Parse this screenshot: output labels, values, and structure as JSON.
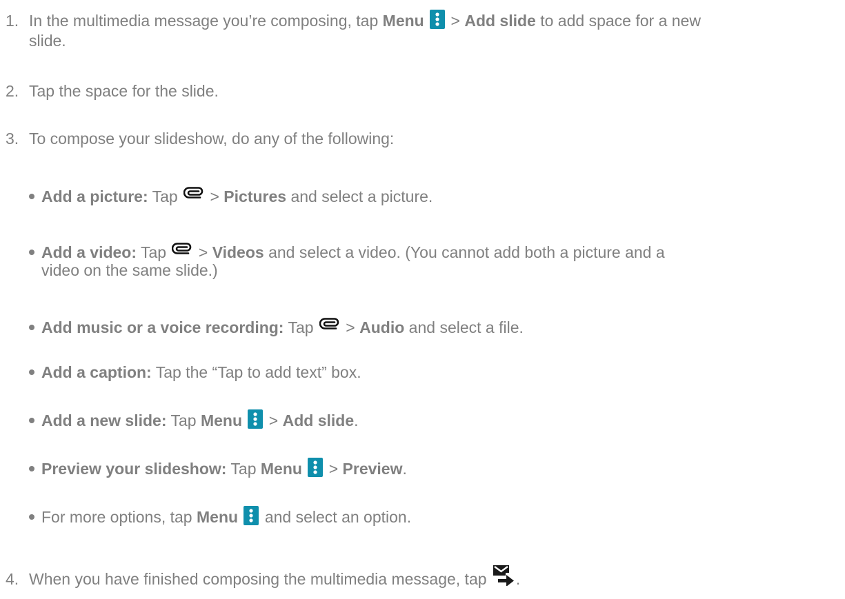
{
  "steps": [
    {
      "num": "1.",
      "line1_pre": "In the multimedia message you’re composing, tap ",
      "menu": "Menu",
      "sep": " > ",
      "target": "Add slide",
      "line1_post": " to add space for a new",
      "line2": "slide."
    },
    {
      "num": "2.",
      "text": "Tap the space for the slide."
    },
    {
      "num": "3.",
      "text": "To compose your slideshow, do any of the following:"
    },
    {
      "num": "4.",
      "text": "When you have finished composing the multimedia message, tap ",
      "end": "."
    }
  ],
  "bullets": [
    {
      "label": "Add a picture:",
      "pre": " Tap ",
      "sep": " > ",
      "target": "Pictures",
      "post": " and select a picture."
    },
    {
      "label": "Add a video:",
      "pre": " Tap ",
      "sep": " > ",
      "target": "Videos",
      "post": " and select a video. (You cannot add both a picture and a",
      "line2": "video on the same slide.)"
    },
    {
      "label": "Add music or a voice recording:",
      "pre": " Tap ",
      "sep": " > ",
      "target": "Audio",
      "post": " and select a file."
    },
    {
      "label": "Add a caption:",
      "post": " Tap the “Tap to add text” box."
    },
    {
      "label": "Add a new slide:",
      "pre": " Tap ",
      "menu": "Menu",
      "sep": " > ",
      "target": "Add slide",
      "end": "."
    },
    {
      "label": "Preview your slideshow:",
      "pre": " Tap ",
      "menu": "Menu",
      "sep": " > ",
      "target": "Preview",
      "end": "."
    },
    {
      "pre": "For more options, tap ",
      "menu": "Menu",
      "post": " and select an option."
    }
  ],
  "icons": {
    "menu": "menu-icon",
    "attach": "paperclip-icon",
    "send": "send-mms-icon",
    "accent_color": "#0f8fac",
    "send_color": "#1a1a1a"
  }
}
